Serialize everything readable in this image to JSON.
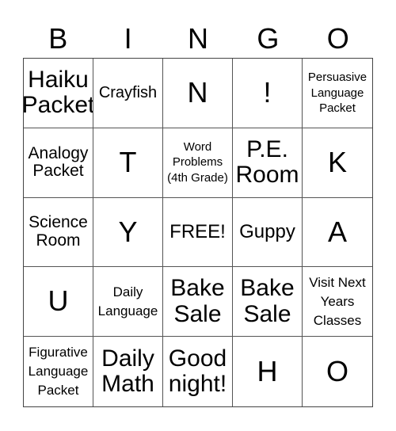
{
  "header": {
    "letters": [
      "B",
      "I",
      "N",
      "G",
      "O"
    ]
  },
  "cells": [
    [
      "Haiku Packet",
      "Crayfish",
      "N",
      "!",
      "Persuasive Language Packet"
    ],
    [
      "Analogy Packet",
      "T",
      "Word Problems (4th Grade)",
      "P.E. Room",
      "K"
    ],
    [
      "Science Room",
      "Y",
      "FREE!",
      "Guppy",
      "A"
    ],
    [
      "U",
      "Daily Language",
      "Bake Sale",
      "Bake Sale",
      "Visit Next Years Classes"
    ],
    [
      "Figurative Language Packet",
      "Daily Math",
      "Good night!",
      "H",
      "O"
    ]
  ]
}
